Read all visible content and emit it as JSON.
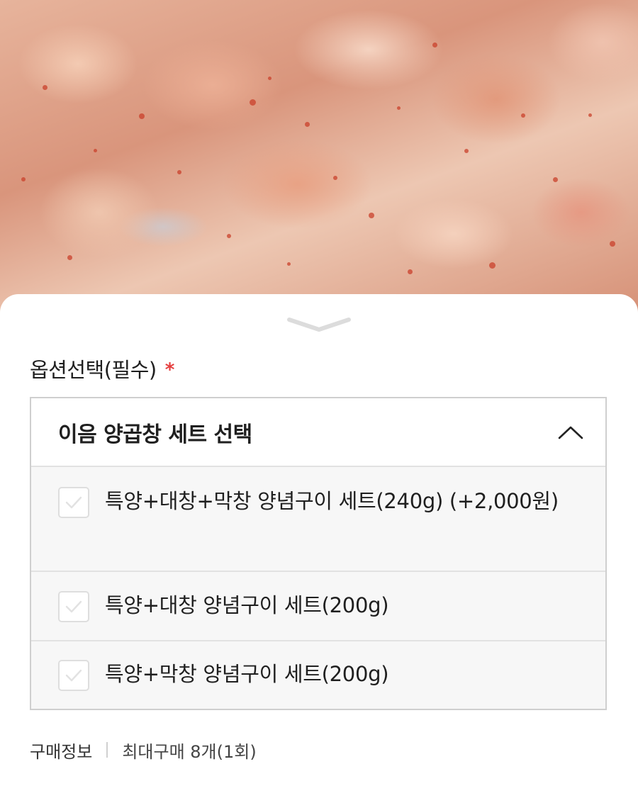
{
  "product_image": {
    "alt": "양념구이 곱창 사진"
  },
  "sheet": {
    "handle_icon": "chevron-down-icon",
    "option_title": "옵션선택(필수)",
    "required_mark": "*",
    "required_color": "#e53e3e",
    "select": {
      "label": "이음 양곱창 세트 선택",
      "expanded": true,
      "toggle_icon": "chevron-up-icon",
      "options": [
        {
          "label": "특양+대창+막창 양념구이 세트(240g) (+2,000원)",
          "checked": false
        },
        {
          "label": "특양+대창 양념구이 세트(200g)",
          "checked": false
        },
        {
          "label": "특양+막창 양념구이 세트(200g)",
          "checked": false
        }
      ]
    },
    "purchase_info": {
      "label": "구매정보",
      "value": "최대구매 8개(1회)"
    }
  }
}
